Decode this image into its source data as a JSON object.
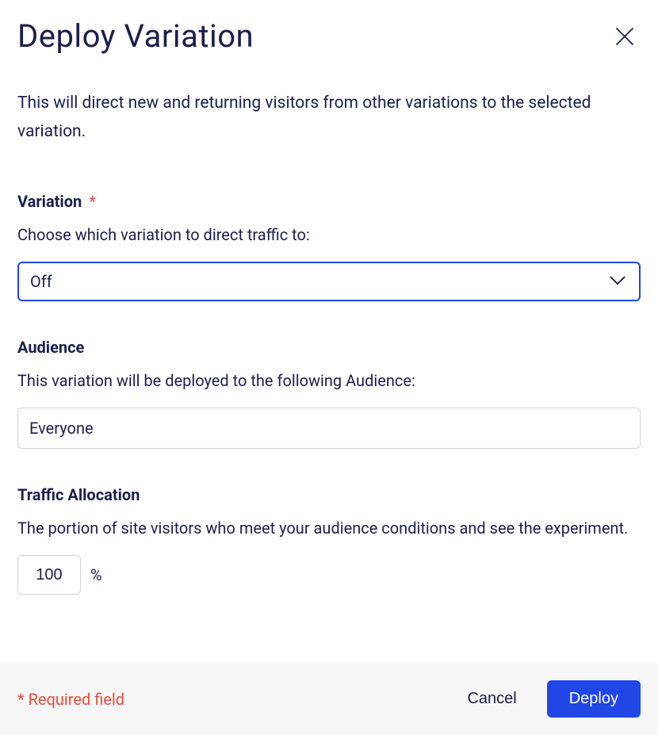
{
  "dialog": {
    "title": "Deploy Variation",
    "description": "This will direct new and returning visitors from other variations to the selected variation."
  },
  "variation": {
    "label": "Variation",
    "help": "Choose which variation to direct traffic to:",
    "value": "Off"
  },
  "audience": {
    "label": "Audience",
    "help": "This variation will be deployed to the following Audience:",
    "value": "Everyone"
  },
  "traffic": {
    "label": "Traffic Allocation",
    "help": "The portion of site visitors who meet your audience conditions and see the experiment.",
    "value": "100",
    "unit": "%"
  },
  "footer": {
    "required_note": "* Required field",
    "cancel": "Cancel",
    "deploy": "Deploy"
  }
}
